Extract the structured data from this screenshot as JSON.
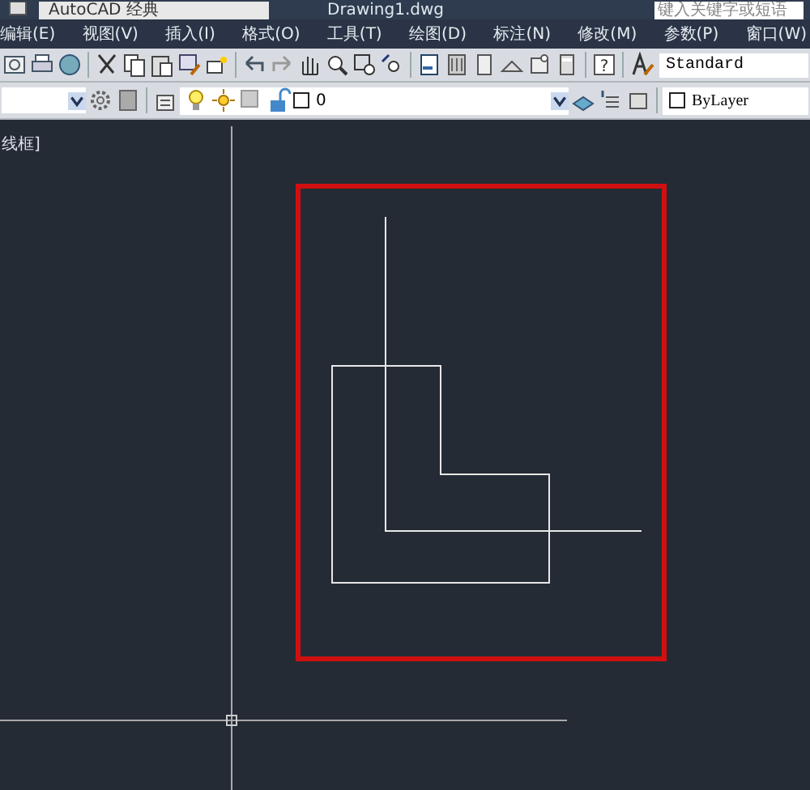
{
  "title_bar": {
    "workspace": "AutoCAD 经典",
    "document_title": "Drawing1.dwg",
    "search_placeholder": "键入关键字或短语"
  },
  "menu_bar": [
    "编辑(E)",
    "视图(V)",
    "插入(I)",
    "格式(O)",
    "工具(T)",
    "绘图(D)",
    "标注(N)",
    "修改(M)",
    "参数(P)",
    "窗口(W)"
  ],
  "toolbar": {
    "help_glyph": "?",
    "text_style": "Standard"
  },
  "layer_bar": {
    "layer": "0",
    "color_control": "ByLayer"
  },
  "viewport": {
    "label": "线框]"
  }
}
